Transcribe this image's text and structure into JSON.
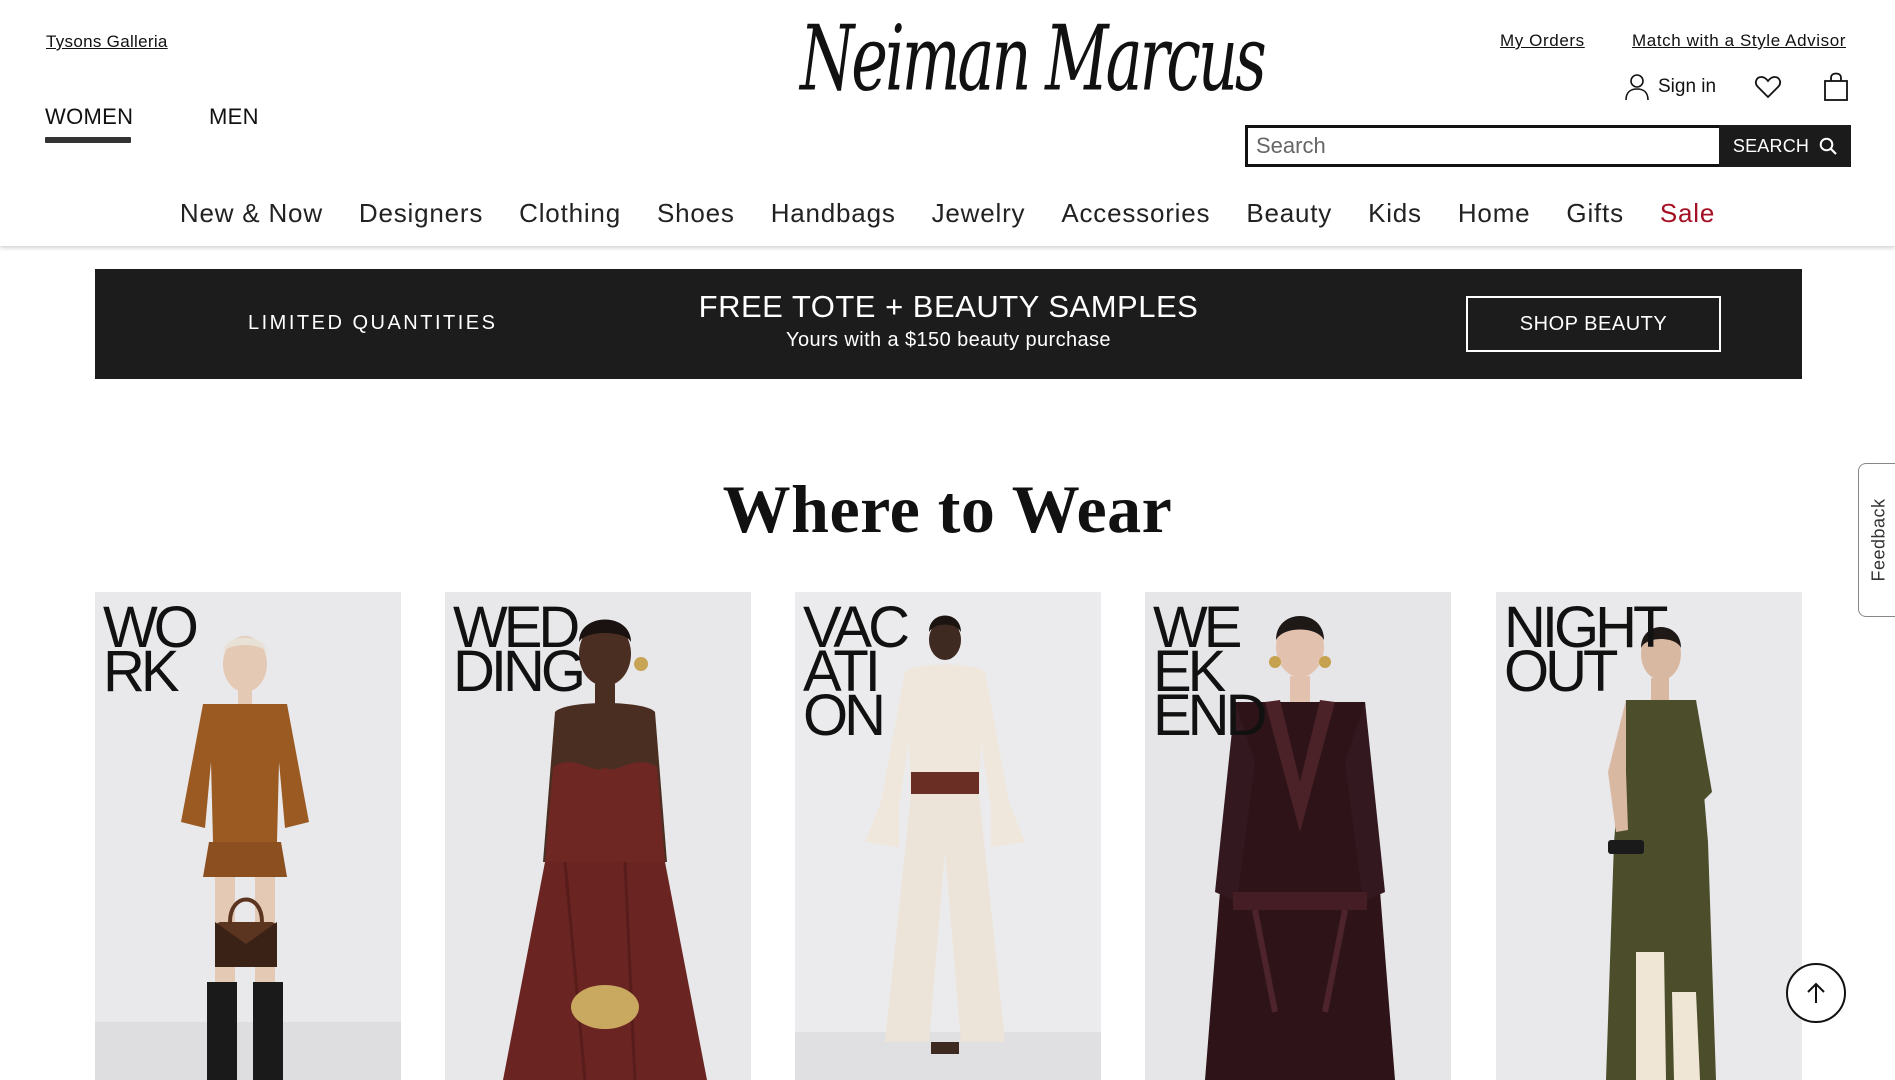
{
  "header": {
    "store_link": "Tysons Galleria",
    "gender_tabs": [
      {
        "label": "WOMEN",
        "active": true
      },
      {
        "label": "MEN",
        "active": false
      }
    ],
    "logo_text": "Neiman Marcus",
    "my_orders": "My Orders",
    "style_advisor": "Match with a Style Advisor",
    "sign_in": "Sign in",
    "icons": [
      "user-icon",
      "heart-icon",
      "shopping-bag-icon",
      "search-icon"
    ],
    "search": {
      "placeholder": "Search",
      "value": "",
      "button_label": "SEARCH"
    }
  },
  "nav": {
    "categories": [
      {
        "label": "New & Now"
      },
      {
        "label": "Designers"
      },
      {
        "label": "Clothing"
      },
      {
        "label": "Shoes"
      },
      {
        "label": "Handbags"
      },
      {
        "label": "Jewelry"
      },
      {
        "label": "Accessories"
      },
      {
        "label": "Beauty"
      },
      {
        "label": "Kids"
      },
      {
        "label": "Home"
      },
      {
        "label": "Gifts"
      },
      {
        "label": "Sale"
      }
    ],
    "sale_color": "#a50f23"
  },
  "promo": {
    "left_text": "LIMITED QUANTITIES",
    "title": "FREE TOTE + BEAUTY SAMPLES",
    "subtitle": "Yours with a $150 beauty purchase",
    "button_label": "SHOP BEAUTY",
    "background": "#1c1c1c"
  },
  "section": {
    "title": "Where to Wear",
    "cards": [
      {
        "label": "WO\nRK",
        "outfit_color": "#9a5a22"
      },
      {
        "label": "WED\nDING",
        "outfit_color": "#6e2723"
      },
      {
        "label": "VAC\nATI\nON",
        "outfit_color": "#efe7db"
      },
      {
        "label": "WE\nEK\nEND",
        "outfit_color": "#2e1418"
      },
      {
        "label": "NIGHT\nOUT",
        "outfit_color": "#4c4d2a"
      }
    ]
  },
  "floating": {
    "feedback": "Feedback"
  }
}
